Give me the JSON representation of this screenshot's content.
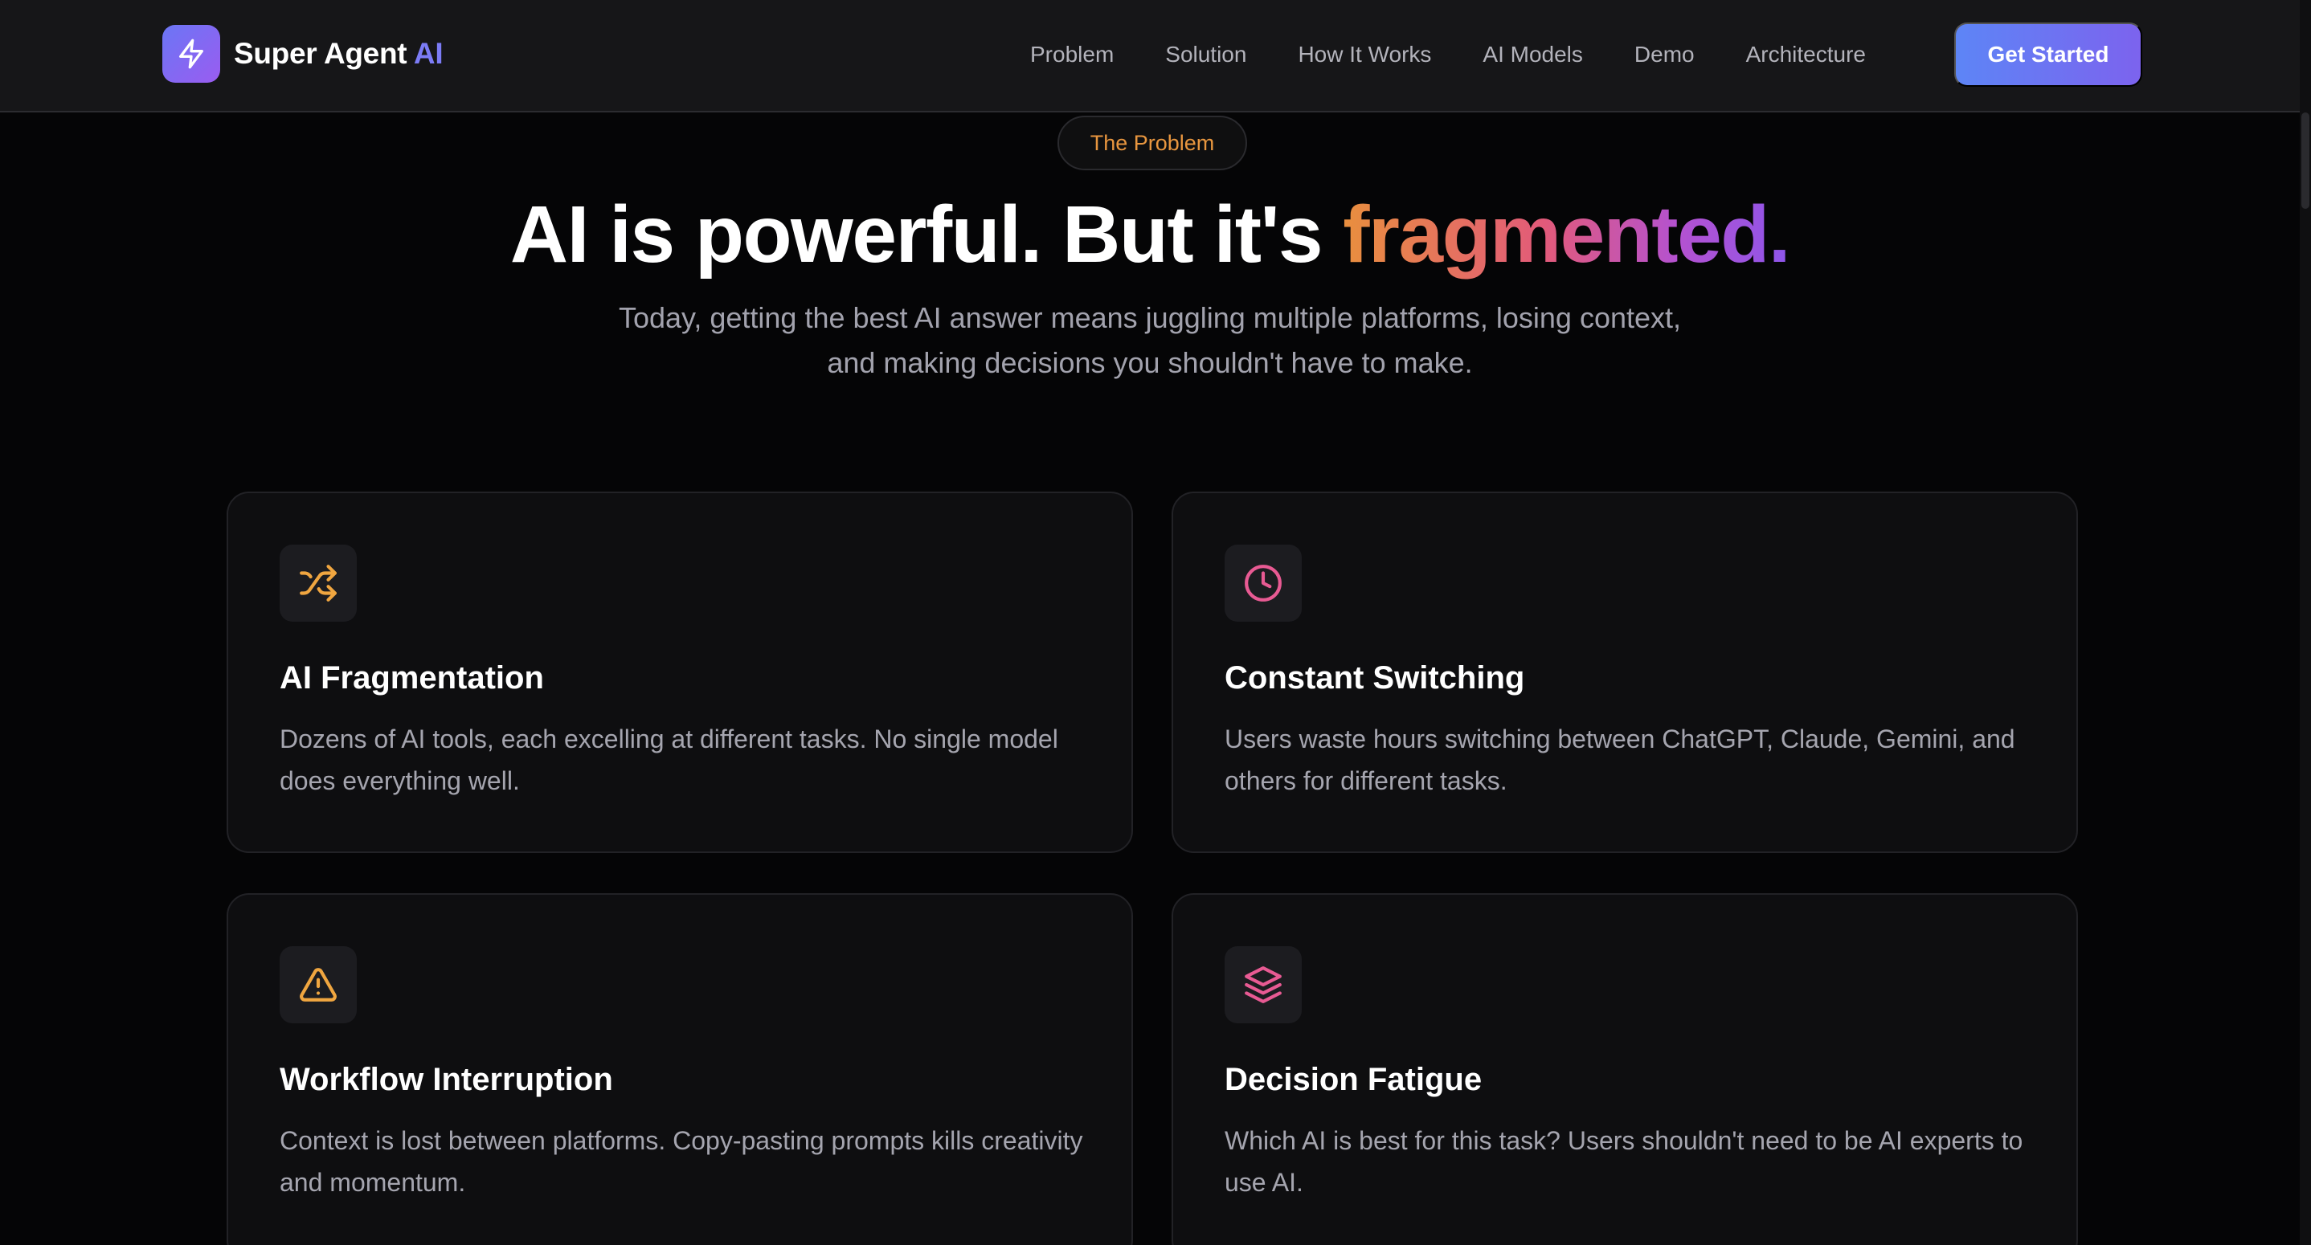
{
  "brand": {
    "name": "Super Agent",
    "accent": "AI",
    "logo_icon": "lightning-bolt-icon"
  },
  "nav": {
    "links": [
      "Problem",
      "Solution",
      "How It Works",
      "AI Models",
      "Demo",
      "Architecture"
    ],
    "cta_label": "Get Started"
  },
  "hero": {
    "pill": "The Problem",
    "headline_main": "AI is powerful. But it's ",
    "headline_accent": "fragmented.",
    "subheadline": "Today, getting the best AI answer means juggling multiple platforms, losing context, and making decisions you shouldn't have to make."
  },
  "cards": [
    {
      "icon": "shuffle-icon",
      "icon_color": "#f0a640",
      "title": "AI Fragmentation",
      "description": "Dozens of AI tools, each excelling at different tasks. No single model does everything well."
    },
    {
      "icon": "clock-icon",
      "icon_color": "#e85a93",
      "title": "Constant Switching",
      "description": "Users waste hours switching between ChatGPT, Claude, Gemini, and others for different tasks."
    },
    {
      "icon": "warning-triangle-icon",
      "icon_color": "#f0a640",
      "title": "Workflow Interruption",
      "description": "Context is lost between platforms. Copy-pasting prompts kills creativity and momentum."
    },
    {
      "icon": "layers-icon",
      "icon_color": "#e85a93",
      "title": "Decision Fatigue",
      "description": "Which AI is best for this task? Users shouldn't need to be AI experts to use AI."
    }
  ],
  "colors": {
    "background": "#050506",
    "navbar": "#161618",
    "card": "#0e0e10",
    "accent_orange": "#e8963f",
    "accent_pink": "#e25a7a",
    "accent_purple": "#8e55ea",
    "cta_gradient": [
      "#5d85f6",
      "#7c63ee"
    ]
  }
}
